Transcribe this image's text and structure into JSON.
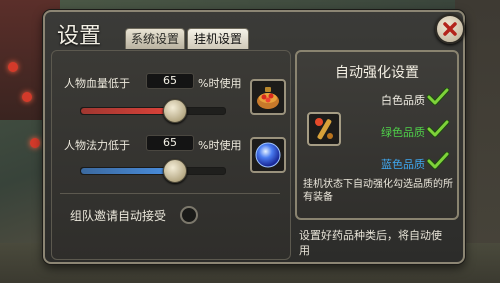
{
  "dialog": {
    "title": "设置",
    "tabs": [
      {
        "label": "系统设置",
        "active": false
      },
      {
        "label": "挂机设置",
        "active": true
      }
    ]
  },
  "hp": {
    "label_prefix": "人物血量低于",
    "value": "65",
    "label_suffix": "%时使用",
    "slider_percent": 65,
    "slider_color": "#e0433a",
    "item_icon": "health-potion-icon"
  },
  "mp": {
    "label_prefix": "人物法力低于",
    "value": "65",
    "label_suffix": "%时使用",
    "slider_percent": 65,
    "slider_color": "#4a8fe0",
    "item_icon": "mana-orb-icon"
  },
  "team": {
    "label": "组队邀请自动接受",
    "checked": false
  },
  "auto_enhance": {
    "title": "自动强化设置",
    "qualities": [
      {
        "label": "白色品质",
        "color": "#f1eee4",
        "checked": true
      },
      {
        "label": "绿色品质",
        "color": "#4fd14a",
        "checked": true
      },
      {
        "label": "蓝色品质",
        "color": "#3fa8f0",
        "checked": true
      }
    ],
    "item_icon": "enhance-scroll-icon",
    "note": "挂机状态下自动强化勾选品质的所有装备"
  },
  "footer_note": "设置好药品种类后，将自动使用"
}
